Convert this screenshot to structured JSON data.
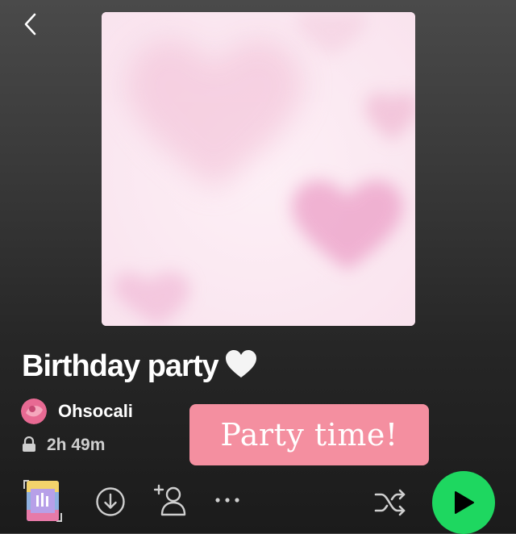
{
  "playlist": {
    "title": "Birthday party",
    "owner": "Ohsocali",
    "duration": "2h 49m"
  },
  "sticker": {
    "text": "Party time!"
  },
  "icons": {
    "back": "chevron-left-icon",
    "title_emoji": "white-heart-icon",
    "lock": "lock-icon",
    "download": "download-circle-icon",
    "add_collaborator": "add-person-icon",
    "more": "more-dots-icon",
    "shuffle": "shuffle-icon",
    "play": "play-icon"
  },
  "colors": {
    "accent_green": "#1ed760",
    "sticker_pink": "#f48fa0",
    "cover_pink": "#fbe9f2"
  }
}
